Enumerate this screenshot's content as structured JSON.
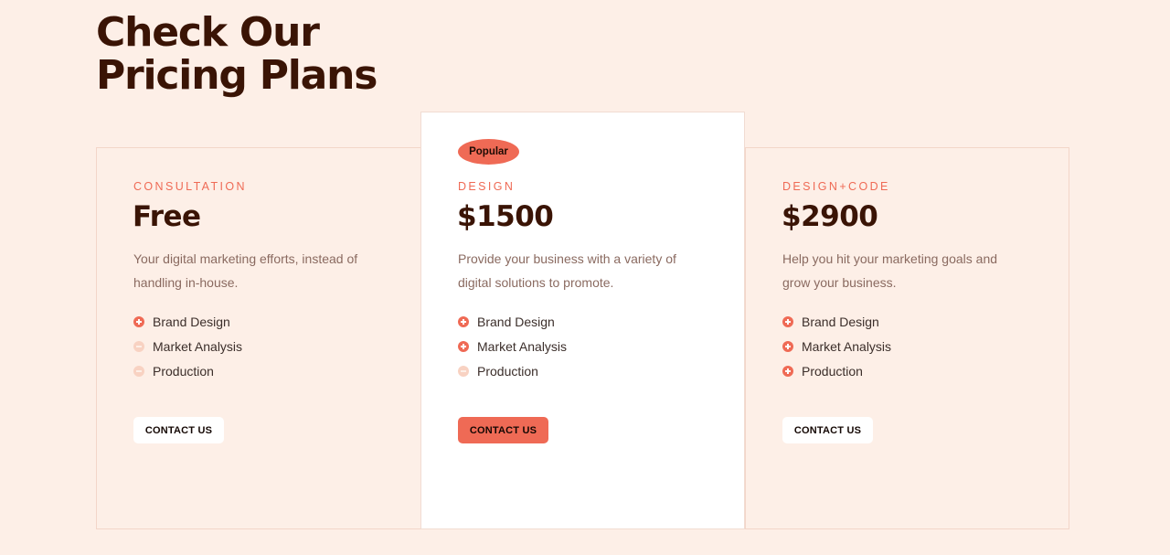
{
  "section": {
    "title_line1": "Check Our",
    "title_line2": "Pricing Plans"
  },
  "plans": [
    {
      "tier": "CONSULTATION",
      "price": "Free",
      "description": "Your digital marketing efforts, instead of handling in-house.",
      "features": [
        {
          "label": "Brand Design",
          "included": true,
          "icon": "plus-circle-icon"
        },
        {
          "label": "Market Analysis",
          "included": false,
          "icon": "minus-circle-icon"
        },
        {
          "label": "Production",
          "included": false,
          "icon": "minus-circle-icon"
        }
      ],
      "cta": "CONTACT US",
      "cta_style": "light"
    },
    {
      "badge": "Popular",
      "tier": "DESIGN",
      "price": "$1500",
      "description": "Provide your business with a variety of digital solutions to promote.",
      "features": [
        {
          "label": "Brand Design",
          "included": true,
          "icon": "plus-circle-icon"
        },
        {
          "label": "Market Analysis",
          "included": true,
          "icon": "plus-circle-icon"
        },
        {
          "label": "Production",
          "included": false,
          "icon": "minus-circle-icon"
        }
      ],
      "cta": "CONTACT US",
      "cta_style": "accent"
    },
    {
      "tier": "DESIGN+CODE",
      "price": "$2900",
      "description": "Help you hit your marketing goals and grow your business.",
      "features": [
        {
          "label": "Brand Design",
          "included": true,
          "icon": "plus-circle-icon"
        },
        {
          "label": "Market Analysis",
          "included": true,
          "icon": "plus-circle-icon"
        },
        {
          "label": "Production",
          "included": true,
          "icon": "plus-circle-icon"
        }
      ],
      "cta": "CONTACT US",
      "cta_style": "light"
    }
  ],
  "colors": {
    "background": "#fdefe7",
    "heading": "#3a1405",
    "accent": "#ef6a55",
    "feature_off": "#f8d2c2",
    "body_text": "#8a6a60"
  }
}
